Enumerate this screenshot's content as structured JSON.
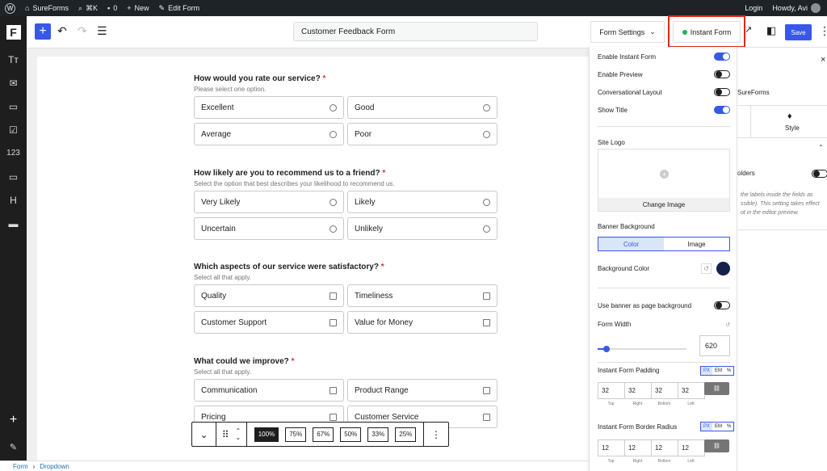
{
  "adminbar": {
    "site_name": "SureForms",
    "shortcut": "⌘K",
    "comments_count": "0",
    "new_label": "New",
    "edit_label": "Edit Form",
    "login_label": "Login",
    "howdy_label": "Howdy, Avi"
  },
  "header": {
    "form_title": "Customer Feedback Form",
    "form_settings_label": "Form Settings",
    "instant_form_label": "Instant Form",
    "save_label": "Save"
  },
  "left_tools": [
    "Tт",
    "✉",
    "▭",
    "☑",
    "123",
    "▭",
    "H",
    "▬"
  ],
  "questions": [
    {
      "title": "How would you rate our service?",
      "required": "*",
      "help": "Please select one option.",
      "type": "radio",
      "options": [
        "Excellent",
        "Good",
        "Average",
        "Poor"
      ]
    },
    {
      "title": "How likely are you to recommend us to a friend?",
      "required": "*",
      "help": "Select the option that best describes your likelihood to recommend us.",
      "type": "radio",
      "options": [
        "Very Likely",
        "Likely",
        "Uncertain",
        "Unlikely"
      ]
    },
    {
      "title": "Which aspects of our service were satisfactory?",
      "required": "*",
      "help": "Select all that apply.",
      "type": "checkbox",
      "options": [
        "Quality",
        "Timeliness",
        "Customer Support",
        "Value for Money"
      ]
    },
    {
      "title": "What could we improve?",
      "required": "*",
      "help": "Select all that apply.",
      "type": "checkbox",
      "options": [
        "Communication",
        "Product Range",
        "Pricing",
        "Customer Service"
      ]
    }
  ],
  "block_toolbar": {
    "widths": [
      "100%",
      "75%",
      "67%",
      "50%",
      "33%",
      "25%"
    ],
    "active": "100%"
  },
  "breadcrumb": {
    "items": [
      "Form",
      "Dropdown"
    ]
  },
  "instant_panel": {
    "enable_instant_form": "Enable Instant Form",
    "enable_preview": "Enable Preview",
    "conversational_layout": "Conversational Layout",
    "show_title": "Show Title",
    "site_logo": "Site Logo",
    "change_image": "Change Image",
    "banner_background": "Banner Background",
    "color_tab": "Color",
    "image_tab": "Image",
    "background_color": "Background Color",
    "background_color_value": "#14224a",
    "use_banner": "Use banner as page background",
    "form_width": "Form Width",
    "form_width_value": "620",
    "form_width_fraction": 0.1,
    "padding_label": "Instant Form Padding",
    "padding_values": [
      "32",
      "32",
      "32",
      "32"
    ],
    "radius_label": "Instant Form Border Radius",
    "radius_values": [
      "12",
      "12",
      "12",
      "12"
    ],
    "side_labels": [
      "Top",
      "Right",
      "Bottom",
      "Left"
    ],
    "units": [
      "PX",
      "EM",
      "%"
    ]
  },
  "right_sidebar": {
    "brand": "SureForms",
    "style_tab": "Style",
    "placeholders": "olders",
    "note": "the labels inside the fields as ssible). This setting takes effect ot in the editor preview."
  }
}
